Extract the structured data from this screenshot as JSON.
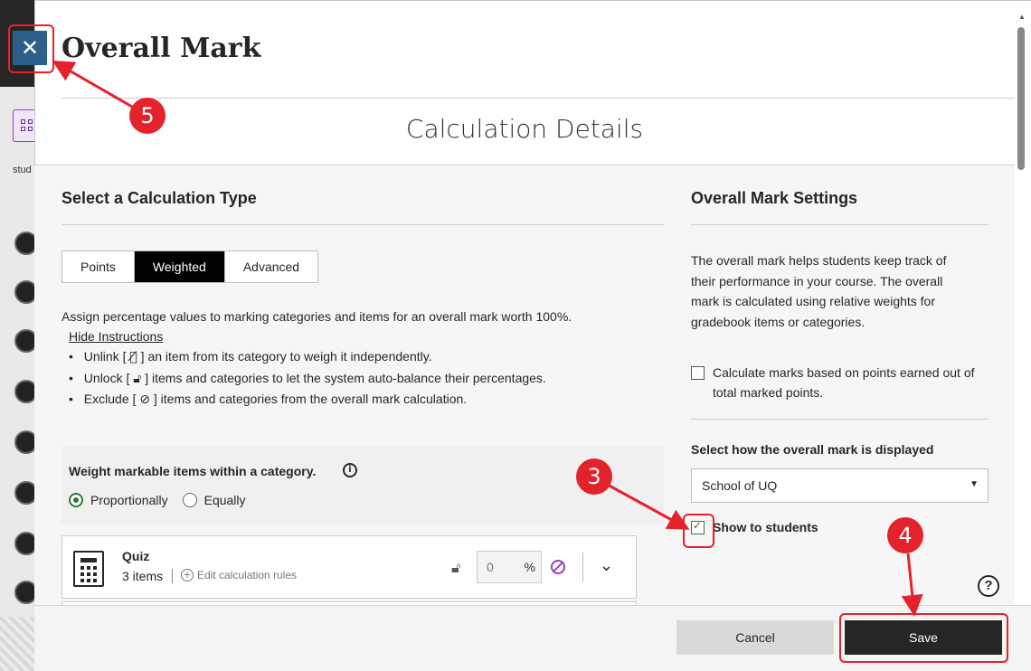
{
  "background": {
    "stud_label": "stud"
  },
  "modal": {
    "title": "Overall Mark",
    "close_glyph": "✕",
    "section_heading": "Calculation Details"
  },
  "calculation_type": {
    "heading": "Select a Calculation Type",
    "options": [
      "Points",
      "Weighted",
      "Advanced"
    ],
    "selected": "Weighted",
    "instructions": "Assign percentage values to marking categories and items for an overall mark worth 100%.",
    "hide_link": "Hide Instructions",
    "bullets": {
      "unlink_pre": "Unlink [",
      "unlink_post": "] an item from its category to weigh it independently.",
      "unlock_pre": "Unlock [",
      "unlock_post": "] items and categories to let the system auto-balance their percentages.",
      "exclude_pre": "Exclude [",
      "exclude_post": "] items and categories from the overall mark calculation."
    }
  },
  "weighting": {
    "title": "Weight markable items within a category.",
    "info_glyph": "i",
    "options": [
      "Proportionally",
      "Equally"
    ],
    "selected": "Proportionally"
  },
  "categories": [
    {
      "name": "Quiz",
      "items": "3 items",
      "edit_label": "Edit calculation rules",
      "percent_value": "0",
      "percent_symbol": "%"
    }
  ],
  "settings": {
    "heading": "Overall Mark Settings",
    "description": "The overall mark helps students keep track of their performance in your course. The overall mark is calculated using relative weights for gradebook items or categories.",
    "points_checkbox_label": "Calculate marks based on points earned out of total marked points.",
    "points_checked": false,
    "display_label": "Select how the overall mark is displayed",
    "display_value": "School of UQ",
    "show_students_label": "Show to students",
    "show_students_checked": true,
    "help_glyph": "?"
  },
  "footer": {
    "cancel_label": "Cancel",
    "save_label": "Save"
  },
  "annotations": [
    {
      "number": "3",
      "target": "show-to-students-checkbox"
    },
    {
      "number": "4",
      "target": "save-button"
    },
    {
      "number": "5",
      "target": "close-button"
    }
  ],
  "colors": {
    "annotation_red": "#e4222b",
    "close_blue": "#2c5f8a",
    "check_green": "#2a7a3a",
    "exclude_purple": "#9a3ec2",
    "save_black": "#262626"
  }
}
